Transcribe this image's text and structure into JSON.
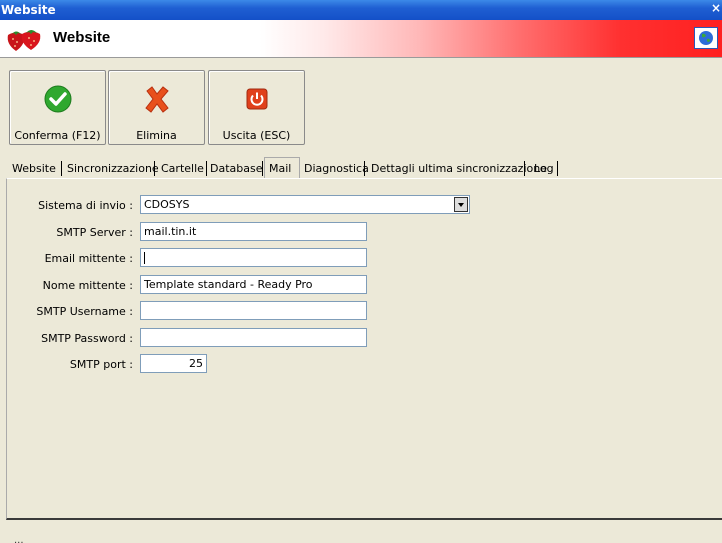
{
  "window": {
    "title": "Website",
    "close_glyph": "×"
  },
  "banner": {
    "app_name": "Website",
    "logo_icon": "strawberry-icon",
    "globe_icon": "globe-icon"
  },
  "toolbar": {
    "buttons": [
      {
        "label": "Conferma (F12)",
        "icon": "check-icon",
        "color": "#2fa82f"
      },
      {
        "label": "Elimina",
        "icon": "x-icon",
        "color": "#e04a1a"
      },
      {
        "label": "Uscita (ESC)",
        "icon": "power-icon",
        "color": "#e0401c"
      }
    ]
  },
  "tabs": [
    {
      "label": "Website"
    },
    {
      "label": "Sincronizzazione"
    },
    {
      "label": "Cartelle"
    },
    {
      "label": "Database"
    },
    {
      "label": "Mail",
      "active": true
    },
    {
      "label": "Diagnostica"
    },
    {
      "label": "Dettagli ultima sincronizzazione"
    },
    {
      "label": "Log"
    }
  ],
  "form": {
    "sistema_label": "Sistema di invio :",
    "sistema_value": "CDOSYS",
    "smtp_server_label": "SMTP Server :",
    "smtp_server_value": "mail.tin.it",
    "email_label": "Email mittente :",
    "email_value": "",
    "nome_label": "Nome mittente :",
    "nome_value": "Template standard - Ready Pro",
    "username_label": "SMTP Username :",
    "username_value": "",
    "password_label": "SMTP Password :",
    "password_value": "",
    "port_label": "SMTP port :",
    "port_value": "25"
  },
  "statusbar": {
    "text": "..."
  }
}
